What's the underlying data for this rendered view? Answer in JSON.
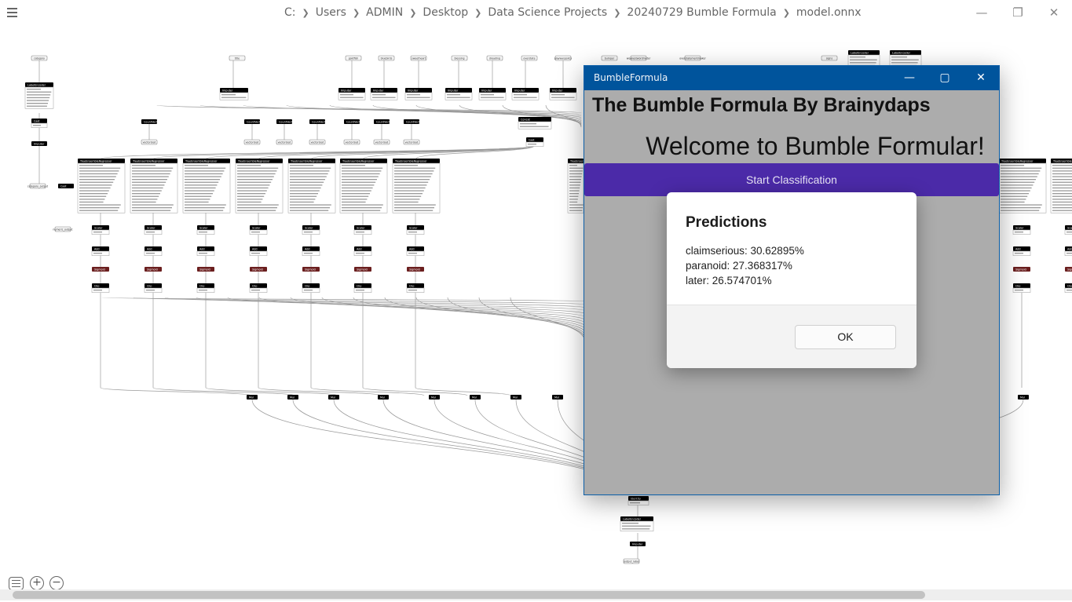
{
  "netron": {
    "path_segments": [
      "C:",
      "Users",
      "ADMIN",
      "Desktop",
      "Data Science Projects",
      "20240729 Bumble Formula",
      "model.onnx"
    ],
    "window_controls": {
      "minimize": "—",
      "restore": "❐",
      "close": "✕"
    },
    "zoom_in": "+",
    "zoom_out": "−"
  },
  "graph": {
    "top_inputs": [
      "category",
      "title",
      "goldfish",
      "bluebirds",
      "sweetheart",
      "blessing",
      "dreading",
      "overstate",
      "playwaspolicy",
      "bumper",
      "weakestwordmeter",
      "overstatementmaker",
      "signs"
    ],
    "nodes": {
      "label_encoder": "LabelEncoder",
      "cast": "Cast",
      "imputer": "Imputer",
      "count_vectorizer": "CountVectorizer",
      "concat": "Concat",
      "tree_ensemble": "TreeEnsembleRegressor",
      "scale": "Scaler",
      "add": "Add",
      "sigmoid": "Sigmoid",
      "clip": "Clip",
      "mul": "Mul",
      "identity": "Identity"
    },
    "outputs": [
      "probabilities",
      "output_label"
    ]
  },
  "app": {
    "window_title": "BumbleFormula",
    "controls": {
      "minimize": "—",
      "maximize": "▢",
      "close": "✕"
    },
    "heading": "The Bumble Formula By Brainydaps",
    "welcome": "Welcome to Bumble Formular!",
    "start_button": "Start Classification"
  },
  "dialog": {
    "title": "Predictions",
    "lines": [
      "claimserious: 30.62895%",
      "paranoid: 27.368317%",
      "later: 26.574701%"
    ],
    "ok_label": "OK"
  },
  "colors": {
    "app_titlebar": "#00549c",
    "app_background": "#acacac",
    "start_button": "#4b2aa8",
    "node_header": "#000000",
    "sigmoid_node": "#6b1f1f"
  }
}
